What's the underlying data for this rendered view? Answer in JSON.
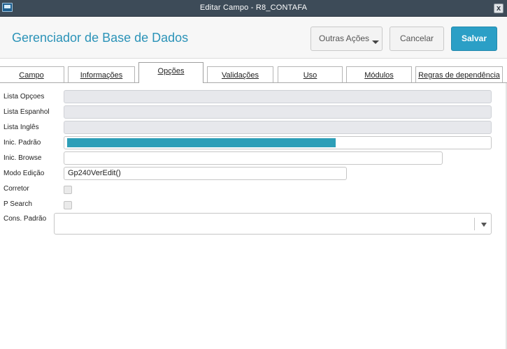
{
  "window": {
    "title": "Editar Campo - R8_CONTAFA",
    "close_label": "x"
  },
  "header": {
    "title": "Gerenciador de Base de Dados",
    "outras_acoes": "Outras Ações",
    "cancelar": "Cancelar",
    "salvar": "Salvar"
  },
  "tabs": [
    {
      "label": "Campo"
    },
    {
      "label": "Informações"
    },
    {
      "label": "Opções"
    },
    {
      "label": "Validações"
    },
    {
      "label": "Uso"
    },
    {
      "label": "Módulos"
    },
    {
      "label": "Regras de dependência"
    }
  ],
  "active_tab": "Opções",
  "form": {
    "lista_opcoes": {
      "label": "Lista Opçoes",
      "value": ""
    },
    "lista_espanhol": {
      "label": "Lista Espanhol",
      "value": ""
    },
    "lista_ingles": {
      "label": "Lista Inglês",
      "value": ""
    },
    "inic_padrao": {
      "label": "Inic. Padrão",
      "value": ""
    },
    "inic_browse": {
      "label": "Inic. Browse",
      "value": ""
    },
    "modo_edicao": {
      "label": "Modo Edição",
      "value": "Gp240VerEdit()"
    },
    "corretor": {
      "label": "Corretor",
      "checked": false
    },
    "p_search": {
      "label": "P Search",
      "checked": false
    },
    "cons_padrao": {
      "label": "Cons. Padrão",
      "value": ""
    }
  },
  "colors": {
    "titlebar": "#3d4b58",
    "accent": "#2b93b8",
    "primary_button": "#2b9fc6",
    "highlight": "#2e9fb8"
  }
}
